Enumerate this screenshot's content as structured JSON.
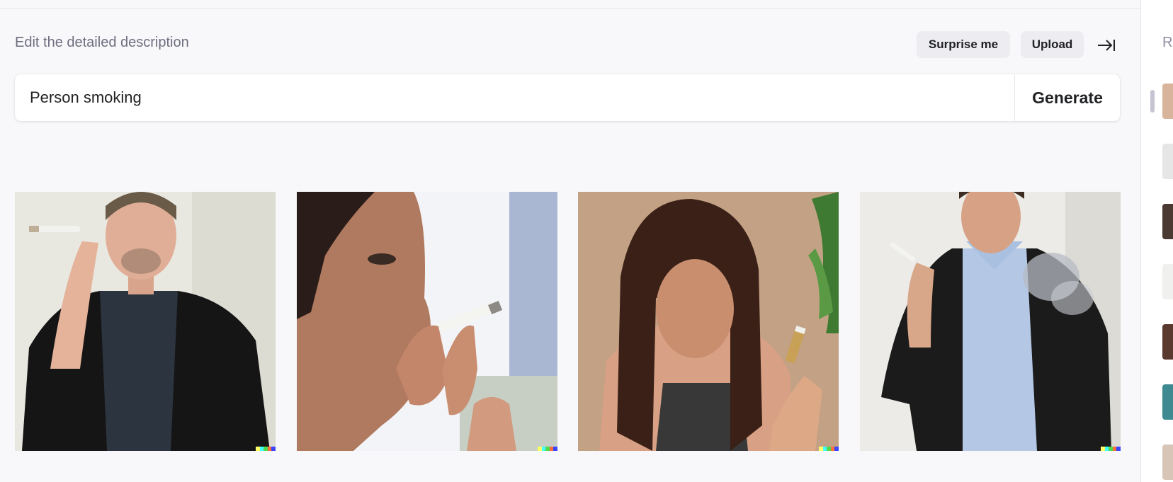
{
  "header": {
    "description_label": "Edit the detailed description",
    "surprise_label": "Surprise me",
    "upload_label": "Upload"
  },
  "prompt": {
    "value": "Person smoking",
    "generate_label": "Generate"
  },
  "results": [
    {
      "subject": "man in black blazer holding cigarette"
    },
    {
      "subject": "close-up profile of man smoking cigarette"
    },
    {
      "subject": "woman with long hair holding cigarette"
    },
    {
      "subject": "man in suit holding cigarette with smoke"
    }
  ],
  "right_panel": {
    "title_partial": "R"
  },
  "colors": {
    "background": "#f8f8fa",
    "pill": "#ececf1",
    "text": "#202123",
    "muted": "#6e6e80",
    "watermark": [
      "#ffff66",
      "#42ffff",
      "#51da4c",
      "#ff6e3c",
      "#3c46ff"
    ]
  },
  "icons": {
    "collapse": "arrow-right-to-bar-icon"
  }
}
